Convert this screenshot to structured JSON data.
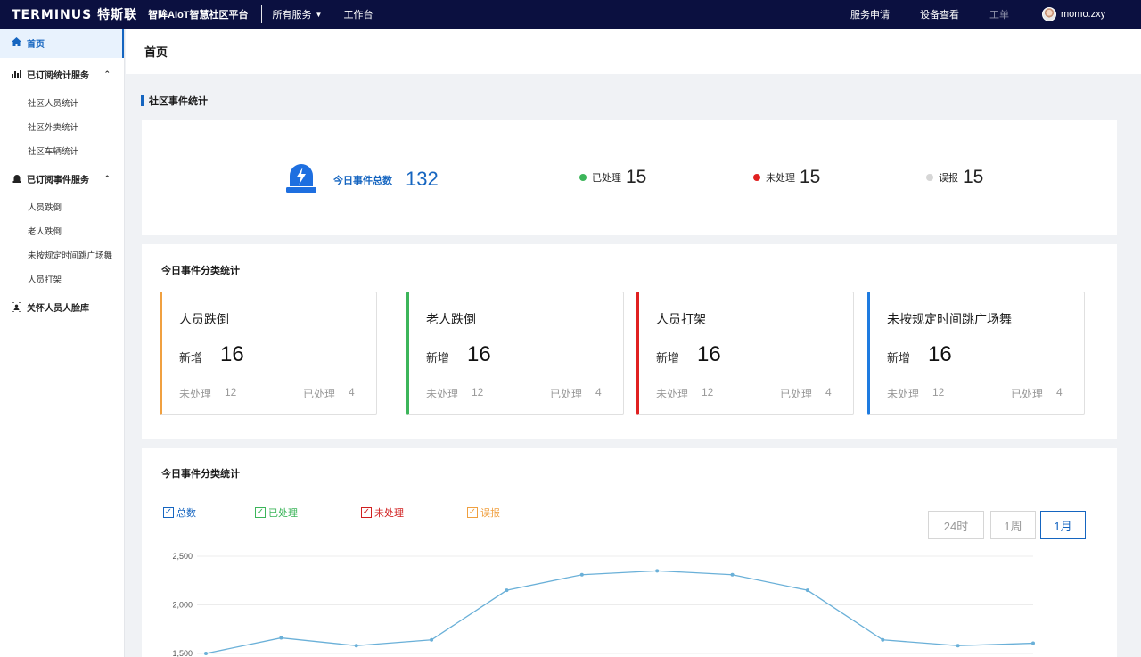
{
  "topbar": {
    "brand": "TERMINUS 特斯联",
    "platform": "智眸AIoT智慧社区平台",
    "nav_all_services": "所有服务",
    "nav_workbench": "工作台",
    "service_apply": "服务申请",
    "device_view": "设备查看",
    "work_order": "工单",
    "username": "momo.zxy"
  },
  "sidebar": {
    "home": "首页",
    "group1": "已订阅统计服务",
    "group1_items": [
      "社区人员统计",
      "社区外卖统计",
      "社区车辆统计"
    ],
    "group2": "已订阅事件服务",
    "group2_items": [
      "人员跌倒",
      "老人跌倒",
      "未按规定时间跳广场舞",
      "人员打架"
    ],
    "group3": "关怀人员人脸库"
  },
  "page": {
    "title": "首页",
    "section_title": "社区事件统计"
  },
  "summary": {
    "total_label": "今日事件总数",
    "total_value": "132",
    "processed_label": "已处理",
    "processed_value": "15",
    "unprocessed_label": "未处理",
    "unprocessed_value": "15",
    "false_label": "误报",
    "false_value": "15",
    "colors": {
      "processed": "#3cb55a",
      "unprocessed": "#e02020",
      "false": "#d6d6d6",
      "accent": "#1565c0"
    }
  },
  "categories": {
    "title": "今日事件分类统计",
    "new_label": "新增",
    "unprocessed_label": "未处理",
    "processed_label": "已处理",
    "items": [
      {
        "name": "人员跌倒",
        "new": "16",
        "unprocessed": "12",
        "processed": "4",
        "color": "#f0a040"
      },
      {
        "name": "老人跌倒",
        "new": "16",
        "unprocessed": "12",
        "processed": "4",
        "color": "#3cb55a"
      },
      {
        "name": "人员打架",
        "new": "16",
        "unprocessed": "12",
        "processed": "4",
        "color": "#e02020"
      },
      {
        "name": "未按规定时间跳广场舞",
        "new": "16",
        "unprocessed": "12",
        "processed": "4",
        "color": "#1e7be0"
      }
    ]
  },
  "trend": {
    "title": "今日事件分类统计",
    "legend": [
      {
        "label": "总数",
        "color": "#1565c0"
      },
      {
        "label": "已处理",
        "color": "#3cb55a"
      },
      {
        "label": "未处理",
        "color": "#d02020"
      },
      {
        "label": "误报",
        "color": "#f0a040"
      }
    ],
    "ranges": [
      "24时",
      "1周",
      "1月"
    ],
    "active_range": "1月"
  },
  "chart_data": {
    "type": "line",
    "y_ticks": [
      "2,500",
      "2,000",
      "1,500"
    ],
    "ylim": [
      1500,
      2500
    ],
    "line_color": "#6ab0d8",
    "series": [
      {
        "values": [
          1500,
          1660,
          1580,
          1640,
          2150,
          2310,
          2350,
          2310,
          2150,
          1640,
          1580,
          1605
        ]
      }
    ]
  }
}
